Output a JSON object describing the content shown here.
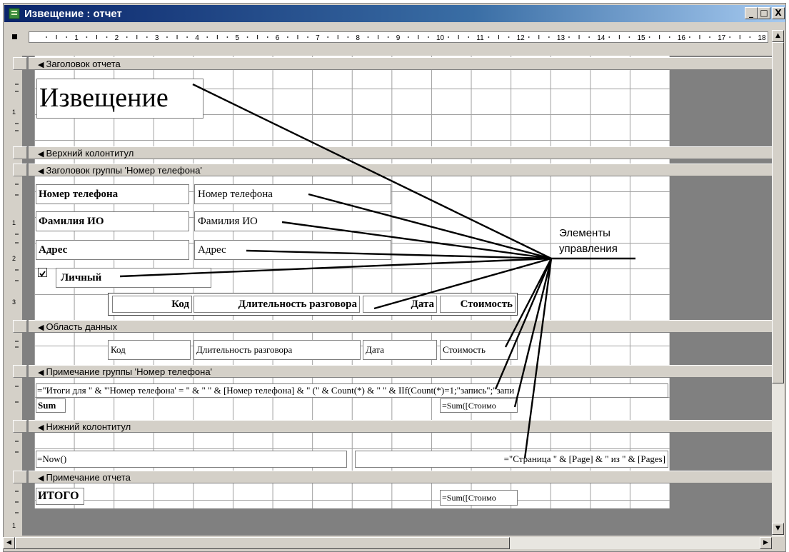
{
  "window": {
    "title": "Извещение : отчет",
    "controls": [
      "_",
      "□",
      "X"
    ]
  },
  "ruler": {
    "h_numbers": [
      "1",
      "2",
      "3",
      "4",
      "5",
      "6",
      "7",
      "8",
      "9",
      "10",
      "11",
      "12",
      "13",
      "14",
      "15",
      "16",
      "17",
      "18"
    ],
    "v_numbers": [
      "1",
      "2",
      "3",
      "1"
    ]
  },
  "sections": {
    "report_header": "Заголовок отчета",
    "page_header": "Верхний колонтитул",
    "group_header": "Заголовок группы 'Номер телефона'",
    "detail": "Область данных",
    "group_footer": "Примечание группы 'Номер телефона'",
    "page_footer": "Нижний колонтитул",
    "report_footer": "Примечание отчета"
  },
  "report_header": {
    "title": "Извещение"
  },
  "group_header": {
    "phone_label": "Номер телефона",
    "phone_field": "Номер телефона",
    "name_label": "Фамилия ИО",
    "name_field": "Фамилия ИО",
    "address_label": "Адрес",
    "address_field": "Адрес",
    "personal_label": "Личный",
    "personal_checked": true,
    "col_code": "Код",
    "col_duration": "Длительность разговора",
    "col_date": "Дата",
    "col_cost": "Стоимость"
  },
  "detail": {
    "code": "Код",
    "duration": "Длительность разговора",
    "date": "Дата",
    "cost": "Стоимость"
  },
  "group_footer": {
    "expression": "=\"Итоги для \" & \"'Номер телефона' = \" & \" \" & [Номер телефона] & \" (\" & Count(*) & \" \" & IIf(Count(*)=1;\"запись\";\"запи",
    "sum_label": "Sum",
    "sum_field": "=Sum([Стоимо"
  },
  "page_footer": {
    "now": "=Now()",
    "page": "=\"Страница \" & [Page] & \" из \" & [Pages]"
  },
  "report_footer": {
    "total_label": "ИТОГО",
    "total_field": "=Sum([Стоимо"
  },
  "callout": {
    "line1": "Элементы",
    "line2": "управления"
  },
  "colors": {
    "title_bar": "#0a246a",
    "face": "#d4d0c8",
    "canvas": "#808080",
    "grid": "#a0a0a0"
  }
}
